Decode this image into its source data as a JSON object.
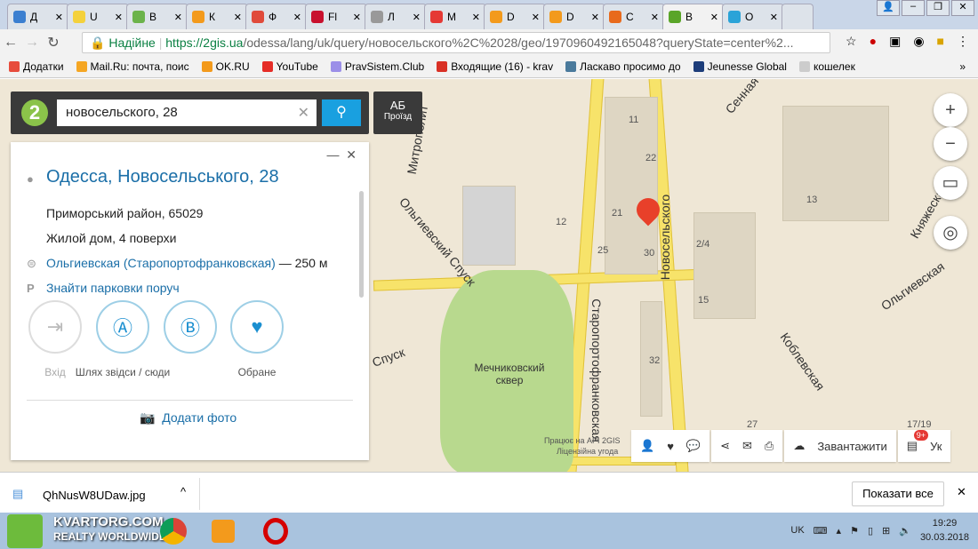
{
  "browser": {
    "tabs": [
      {
        "label": "Д",
        "color": "#3b7fd0"
      },
      {
        "label": "U",
        "color": "#f4d13b"
      },
      {
        "label": "В",
        "color": "#6bb34b"
      },
      {
        "label": "К",
        "color": "#f39a1c"
      },
      {
        "label": "Ф",
        "color": "#e04b3b"
      },
      {
        "label": "Fl",
        "color": "#c8102e"
      },
      {
        "label": "Л",
        "color": "#999999"
      },
      {
        "label": "М",
        "color": "#e53935"
      },
      {
        "label": "D",
        "color": "#f39a1c"
      },
      {
        "label": "D",
        "color": "#f39a1c"
      },
      {
        "label": "С",
        "color": "#e86a1c"
      },
      {
        "label": "В",
        "color": "#5aa528",
        "active": true
      },
      {
        "label": "О",
        "color": "#2aa3d8"
      }
    ],
    "secure_label": "Надійне",
    "url_scheme": "https://",
    "url_host": "2gis.ua",
    "url_rest": "/odessa/lang/uk/query/новосельского%2C%2028/geo/1970960492165048?queryState=center%2...",
    "bookmarks": [
      {
        "label": "Додатки",
        "color": "#e74c3c"
      },
      {
        "label": "Mail.Ru: почта, поис",
        "color": "#f5a623"
      },
      {
        "label": "OK.RU",
        "color": "#f39a1c"
      },
      {
        "label": "YouTube",
        "color": "#e52d27"
      },
      {
        "label": "PravSistem.Club",
        "color": "#9b8fe8"
      },
      {
        "label": "Входящие (16) - krav",
        "color": "#d93025"
      },
      {
        "label": "Ласкаво просимо до",
        "color": "#4a7a9c"
      },
      {
        "label": "Jeunesse Global",
        "color": "#1d3d7a"
      },
      {
        "label": "кошелек",
        "color": "#cccccc"
      }
    ],
    "more": "»"
  },
  "search": {
    "value": "новосельского, 28",
    "route_label": "Проїзд"
  },
  "card": {
    "title": "Одесса, Новосельського, 28",
    "district": "Приморський район, 65029",
    "building": "Жилой дом, 4 поверхи",
    "stop_link": "Ольгиевская (Старопортофранковская)",
    "stop_distance": "— 250 м",
    "parking_link": "Знайти парковки поруч",
    "actions": [
      {
        "label": "Вхід"
      },
      {
        "label": "Шлях звідси / сюди"
      },
      {
        "label": "Обране"
      }
    ],
    "add_photo": "Додати фото"
  },
  "map": {
    "streets": [
      "Ольгиевский Спуск",
      "Новосельского",
      "Старопортофранковская",
      "Коблевская",
      "Ольгиевская",
      "Мечниковский сквер",
      "Спуск",
      "Митрополит",
      "Княжеская",
      "Сенная"
    ],
    "numbers": [
      "22",
      "21",
      "25",
      "30",
      "12",
      "2/4",
      "15",
      "32",
      "11",
      "13",
      "27",
      "17/19"
    ],
    "copyright": "Працює на API 2GIS",
    "license": "Ліцензійна угода",
    "download_label": "Завантажити",
    "lang_label": "Ук",
    "badge": "9+"
  },
  "download_bar": {
    "file": "QhNusW8UDaw.jpg",
    "show_all": "Показати все"
  },
  "taskbar": {
    "watermark_line1": "KVARTORG.COM",
    "watermark_line2": "REALTY WORLDWIDE",
    "lang": "UK",
    "time": "19:29",
    "date": "30.03.2018"
  }
}
